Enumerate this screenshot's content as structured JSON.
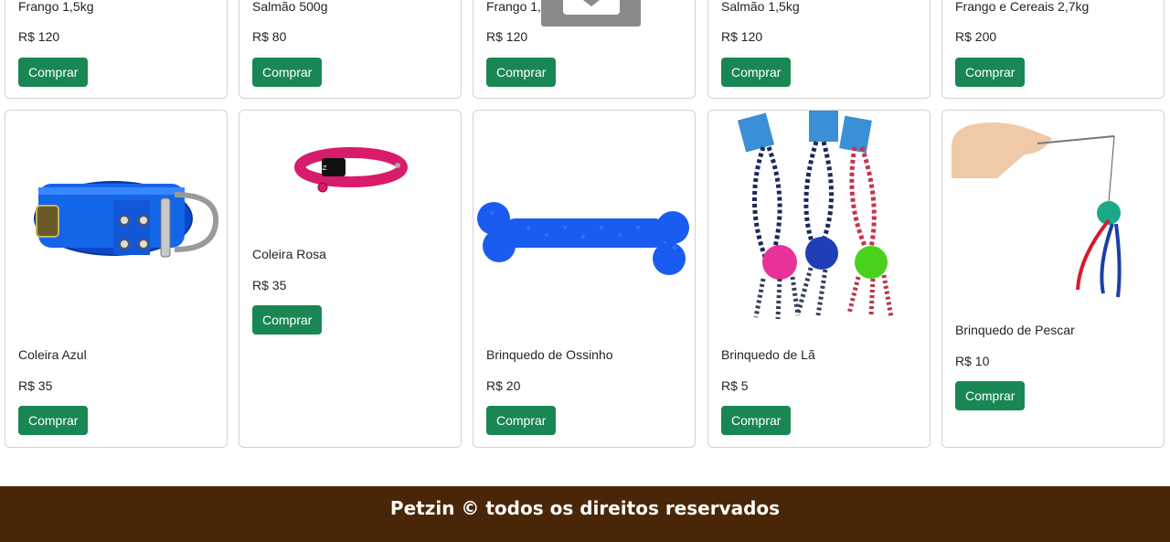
{
  "products_top": [
    {
      "name": "Frango 1,5kg",
      "price": "R$ 120"
    },
    {
      "name": "Salmão 500g",
      "price": "R$ 80"
    },
    {
      "name": "Frango 1,5kg",
      "price": "R$ 120"
    },
    {
      "name": "Salmão 1,5kg",
      "price": "R$ 120"
    },
    {
      "name": "Frango e Cereais 2,7kg",
      "price": "R$ 200"
    }
  ],
  "products_bottom": [
    {
      "name": "Coleira Azul",
      "price": "R$ 35",
      "image": "blue-dog-collar"
    },
    {
      "name": "Coleira Rosa",
      "price": "R$ 35",
      "image": "pink-cat-collar"
    },
    {
      "name": "Brinquedo de Ossinho",
      "price": "R$ 20",
      "image": "blue-bone-toy"
    },
    {
      "name": "Brinquedo de Lã",
      "price": "R$ 5",
      "image": "rope-ball-toys"
    },
    {
      "name": "Brinquedo de Pescar",
      "price": "R$ 10",
      "image": "cat-fishing-wand-toy"
    }
  ],
  "buy_label": "Comprar",
  "footer": {
    "text": "Petzin © todos os direitos reservados"
  },
  "colors": {
    "buy_button": "#198754",
    "footer_bg": "#4a2608"
  }
}
